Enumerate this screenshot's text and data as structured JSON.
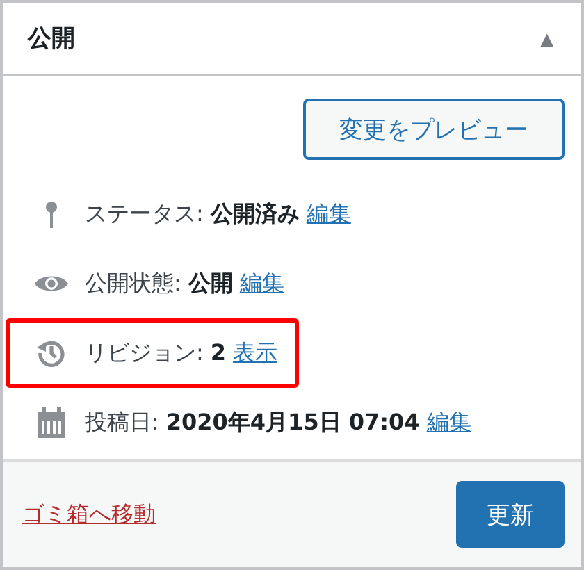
{
  "panel": {
    "title": "公開",
    "collapse_icon": "▲"
  },
  "preview_button": "変更をプレビュー",
  "rows": [
    {
      "kind": "status",
      "label": "ステータス:",
      "value": "公開済み",
      "link": "編集",
      "highlighted": false
    },
    {
      "kind": "visibility",
      "label": "公開状態:",
      "value": "公開",
      "link": "編集",
      "highlighted": false
    },
    {
      "kind": "revisions",
      "label": "リビジョン:",
      "value": "2",
      "link": "表示",
      "highlighted": true
    },
    {
      "kind": "date",
      "label": "投稿日:",
      "value": "2020年4月15日 07:04",
      "link": "編集",
      "highlighted": false
    }
  ],
  "footer": {
    "trash_link": "ゴミ箱へ移動",
    "update_button": "更新"
  }
}
